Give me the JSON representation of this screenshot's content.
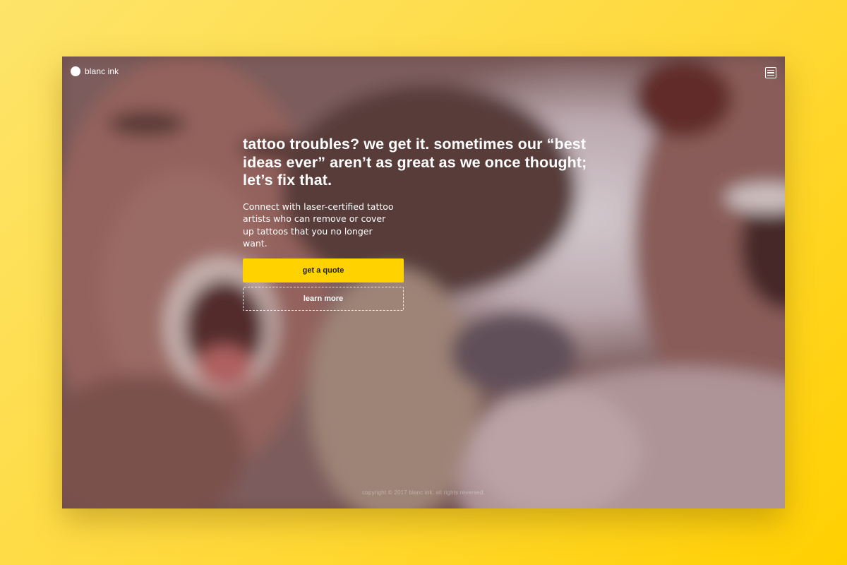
{
  "brand": {
    "name": "blanc ink"
  },
  "hero": {
    "headline": "tattoo troubles? we get it. sometimes our “best ideas ever” aren’t as great as we once thought; let’s fix that.",
    "subcopy": "Connect with laser-certified tattoo artists who can remove or cover up tattoos that you no longer want.",
    "primary_cta": "get a quote",
    "secondary_cta": "learn more"
  },
  "footer": {
    "copyright": "copyright © 2017 blanc ink. all rights reversed."
  },
  "icons": {
    "menu": "menu-icon",
    "logo": "logo-dot-icon"
  },
  "colors": {
    "page_background": "#ffd93a",
    "accent": "#ffd200",
    "text": "#ffffff"
  }
}
